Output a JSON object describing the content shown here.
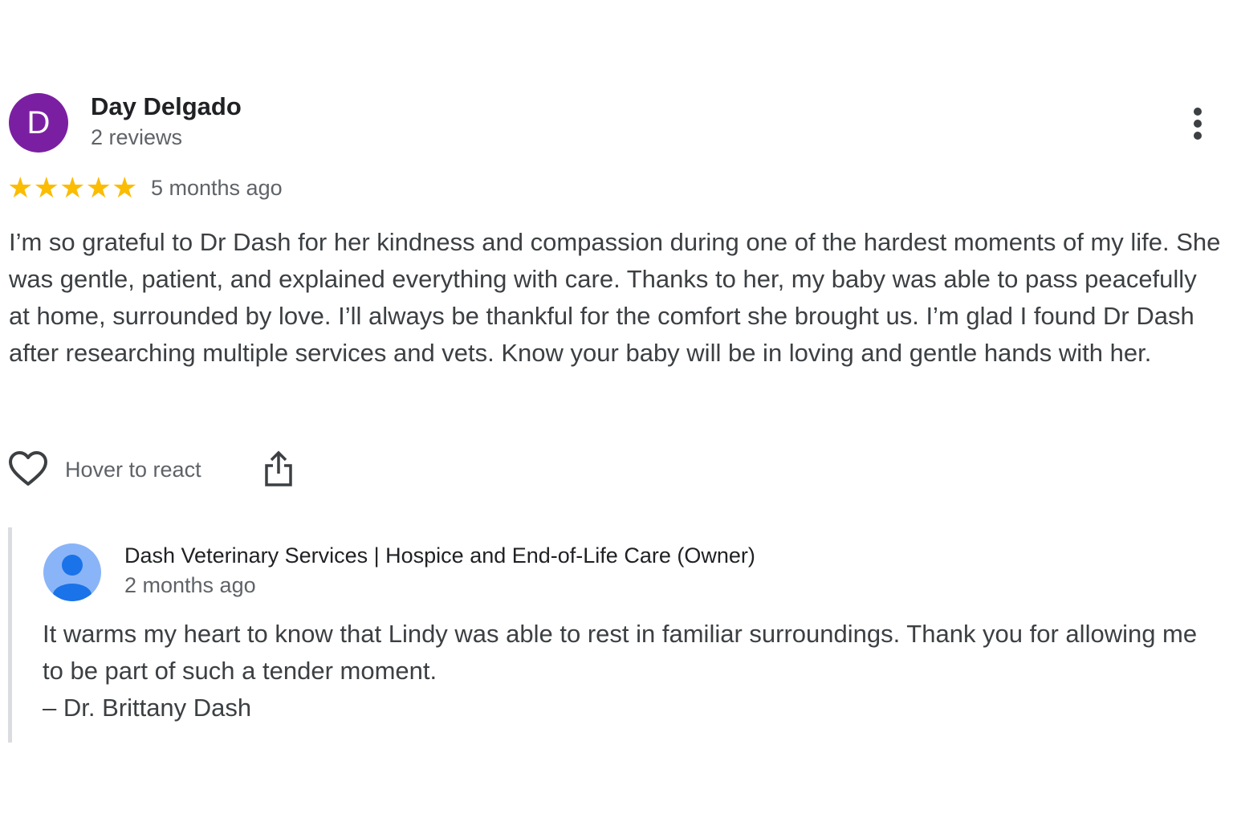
{
  "review": {
    "author": {
      "initial": "D",
      "name": "Day Delgado",
      "meta": "2 reviews",
      "avatar_color": "#7b1fa2"
    },
    "rating": {
      "value": 5,
      "max": 5,
      "star_color": "#fbbc04"
    },
    "time_ago": "5 months ago",
    "text": "I’m so grateful to Dr Dash for her kindness and compassion during one of the hardest moments of my life. She was gentle, patient, and explained everything with care. Thanks to her, my baby was able to pass peacefully at home, surrounded by love. I’ll always be thankful for the comfort she brought us. I’m glad I found Dr Dash after researching multiple services and vets. Know your baby will be in loving and gentle hands with her.",
    "actions": {
      "react_label": "Hover to react",
      "react_icon": "heart-outline-icon",
      "share_icon": "share-icon",
      "more_icon": "more-vertical-icon"
    }
  },
  "owner_reply": {
    "name": "Dash Veterinary Services | Hospice and End-of-Life Care (Owner)",
    "time_ago": "2 months ago",
    "avatar_icon": "person-icon",
    "avatar_color": "#8ab4f8",
    "text_lines": [
      "It warms my heart to know that Lindy was able to rest in familiar surroundings. Thank you for allowing me to be part of such a tender moment.",
      "– Dr. Brittany Dash"
    ]
  }
}
